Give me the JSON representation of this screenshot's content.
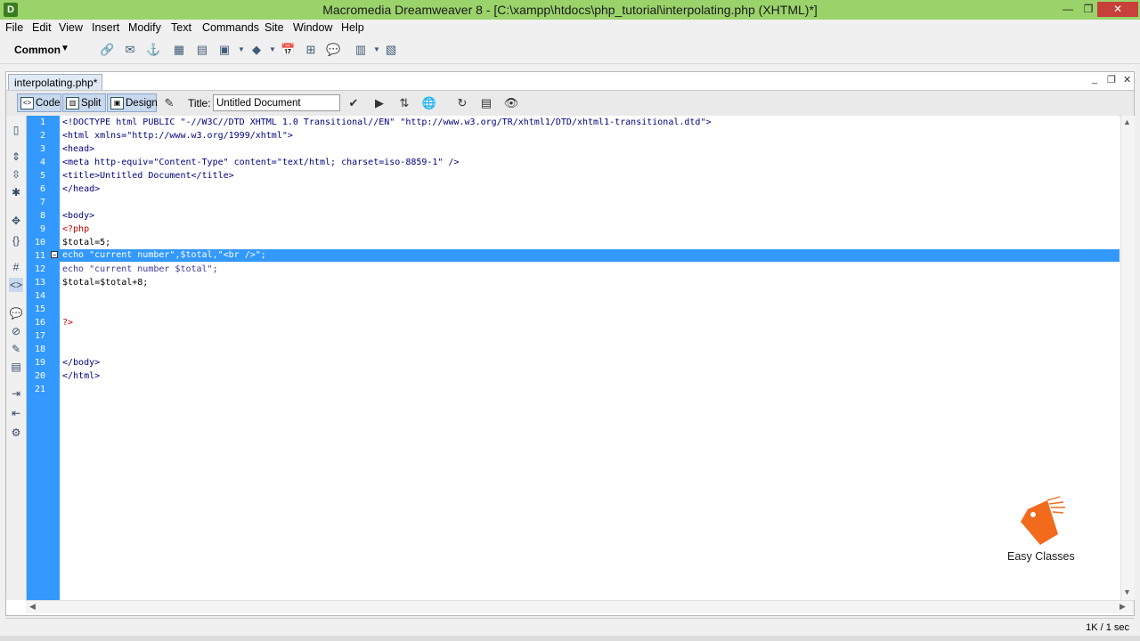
{
  "window": {
    "title": "Macromedia Dreamweaver 8 - [C:\\xampp\\htdocs\\php_tutorial\\interpolating.php (XHTML)*]",
    "controls": {
      "minimize": "—",
      "maximize": "❐",
      "close": "✕"
    }
  },
  "menu": [
    "File",
    "Edit",
    "View",
    "Insert",
    "Modify",
    "Text",
    "Commands",
    "Site",
    "Window",
    "Help"
  ],
  "insert_bar": {
    "category": "Common",
    "caret": "▼"
  },
  "document": {
    "tab": "interpolating.php*",
    "window_controls": {
      "minimize": "_",
      "restore": "❐",
      "close": "✕"
    },
    "views": {
      "code": "Code",
      "split": "Split",
      "design": "Design"
    },
    "title_label": "Title:",
    "title_value": "Untitled Document"
  },
  "code": {
    "line_numbers": [
      "1",
      "2",
      "3",
      "4",
      "5",
      "6",
      "7",
      "8",
      "9",
      "10",
      "11",
      "12",
      "13",
      "14",
      "15",
      "16",
      "17",
      "18",
      "19",
      "20",
      "21"
    ],
    "selected_line": 11,
    "lines": [
      "<!DOCTYPE html PUBLIC \"-//W3C//DTD XHTML 1.0 Transitional//EN\" \"http://www.w3.org/TR/xhtml1/DTD/xhtml1-transitional.dtd\">",
      "<html xmlns=\"http://www.w3.org/1999/xhtml\">",
      "<head>",
      "<meta http-equiv=\"Content-Type\" content=\"text/html; charset=iso-8859-1\" />",
      "<title>Untitled Document</title>",
      "</head>",
      "",
      "<body>",
      "<?php",
      "$total=5;",
      "echo \"current number\",$total,\"<br />\";",
      "echo \"current number $total\";",
      "$total=$total+8;",
      "",
      "",
      "?>",
      "",
      "",
      "</body>",
      "</html>",
      ""
    ]
  },
  "status": {
    "size": "1K / 1 sec"
  },
  "logo": {
    "text": "Easy Classes"
  },
  "colors": {
    "titlebar": "#9bd36b",
    "gutter": "#3399ff",
    "selection": "#3399ff",
    "php_tag": "#cc0000",
    "html_tag": "#000080",
    "logo_orange": "#f26a1b"
  }
}
